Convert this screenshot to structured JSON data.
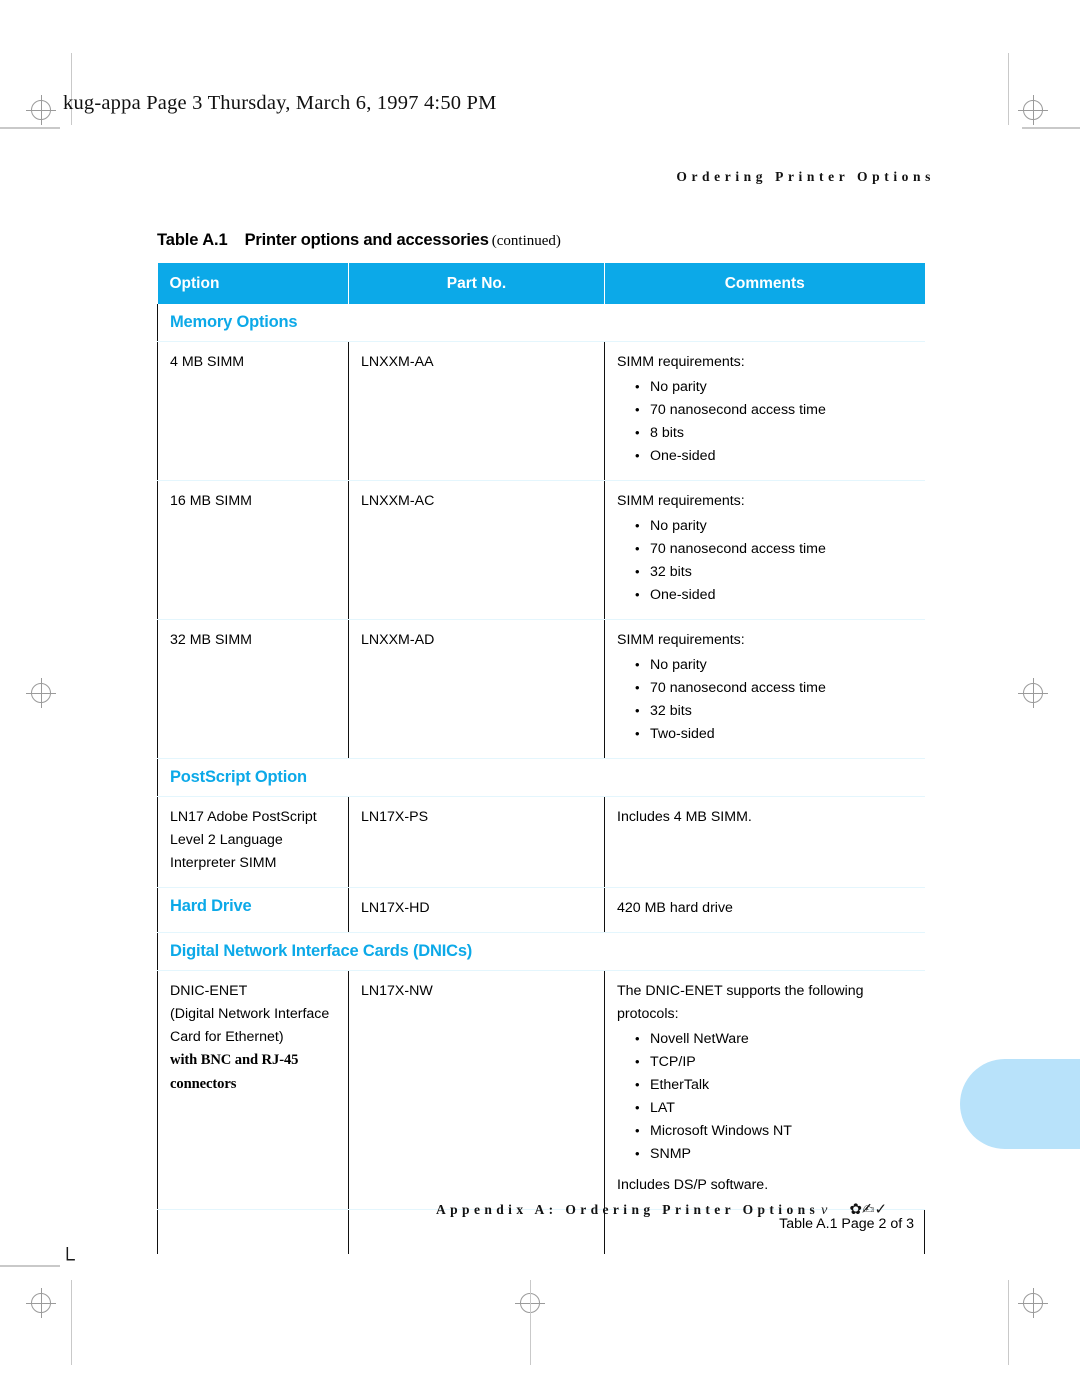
{
  "file_header": "kug-appa  Page 3  Thursday, March 6, 1997  4:50 PM",
  "running_head": "Ordering Printer Options",
  "caption": {
    "label": "Table A.1",
    "title": "Printer options and accessories",
    "continued": "(continued)"
  },
  "table": {
    "headers": [
      "Option",
      "Part No.",
      "Comments"
    ],
    "sections": [
      {
        "heading": "Memory Options",
        "rows": [
          {
            "option": "4 MB SIMM",
            "part_no": "LNXXM-AA",
            "comments_intro": "SIMM requirements:",
            "comments_bullets": [
              "No parity",
              "70 nanosecond access time",
              "8 bits",
              "One-sided"
            ]
          },
          {
            "option": "16 MB SIMM",
            "part_no": "LNXXM-AC",
            "comments_intro": "SIMM requirements:",
            "comments_bullets": [
              "No parity",
              "70 nanosecond access time",
              "32 bits",
              "One-sided"
            ]
          },
          {
            "option": "32 MB SIMM",
            "part_no": "LNXXM-AD",
            "comments_intro": "SIMM requirements:",
            "comments_bullets": [
              "No parity",
              "70 nanosecond access time",
              "32 bits",
              "Two-sided"
            ]
          }
        ]
      },
      {
        "heading": "PostScript Option",
        "rows": [
          {
            "option_line1": "LN17 Adobe PostScript",
            "option_line2": "Level 2 Language",
            "option_line3": "Interpreter SIMM",
            "part_no": "LN17X-PS",
            "comments_intro": "Includes 4 MB SIMM."
          }
        ]
      },
      {
        "heading": "Hard Drive",
        "inline": true,
        "rows": [
          {
            "part_no": "LN17X-HD",
            "comments_intro": "420 MB hard drive"
          }
        ]
      },
      {
        "heading": "Digital Network Interface Cards (DNICs)",
        "rows": [
          {
            "option_line1": "DNIC-ENET",
            "option_line2": "(Digital Network Interface",
            "option_line3": "Card for Ethernet)",
            "option_bold1": "with BNC and RJ-45",
            "option_bold2": "connectors",
            "part_no": "LN17X-NW",
            "comments_intro": "The DNIC-ENET supports the following protocols:",
            "comments_bullets": [
              "Novell NetWare",
              "TCP/IP",
              "EtherTalk",
              "LAT",
              "Microsoft Windows NT",
              "SNMP"
            ],
            "comments_after": "Includes DS/P software."
          }
        ]
      }
    ],
    "table_footer": "Table A.1  Page 2 of 3"
  },
  "page_footer": {
    "text": "Appendix A: Ordering Printer Options",
    "page_number": "v",
    "dingbats": "✿✍✓"
  },
  "colors": {
    "accent_cyan": "#0ca9e8",
    "thumb_tab": "#b8e2fa",
    "row_rule": "#e4f6fd"
  },
  "bullet_glyph": "•"
}
